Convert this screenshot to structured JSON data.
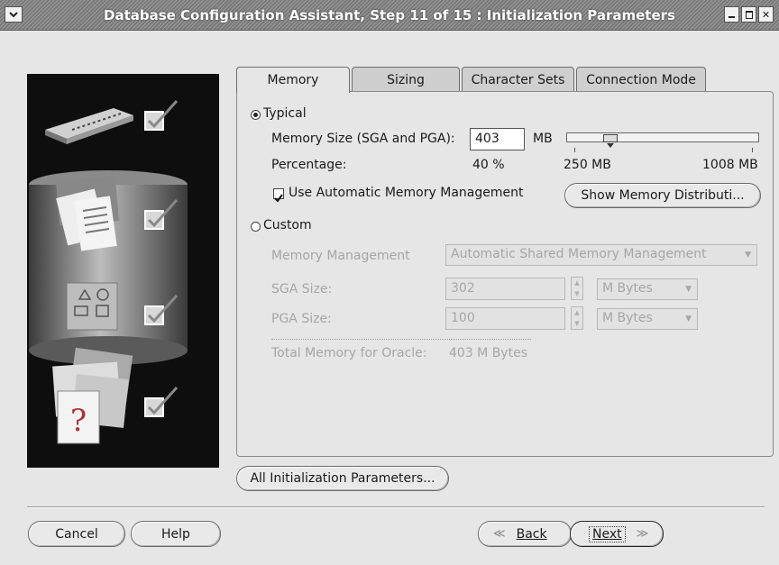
{
  "window": {
    "title": "Database Configuration Assistant, Step 11 of 15 : Initialization Parameters",
    "controls": [
      "minimize",
      "maximize",
      "close"
    ]
  },
  "tabs": [
    {
      "label": "Memory",
      "active": true
    },
    {
      "label": "Sizing",
      "active": false
    },
    {
      "label": "Character Sets",
      "active": false
    },
    {
      "label": "Connection Mode",
      "active": false
    }
  ],
  "memory": {
    "typical": {
      "label": "Typical",
      "selected": true,
      "memory_size_label": "Memory Size (SGA and PGA):",
      "memory_size_value": "403",
      "unit": "MB",
      "slider_min_label": "250 MB",
      "slider_max_label": "1008 MB",
      "slider_value_mb": 403,
      "percentage_label": "Percentage:",
      "percentage_value": "40 %",
      "amm_label": "Use Automatic Memory Management",
      "amm_checked": true,
      "show_distribution_button": "Show Memory Distributi..."
    },
    "custom": {
      "label": "Custom",
      "selected": false,
      "memory_management_label": "Memory Management",
      "memory_management_value": "Automatic Shared Memory Management",
      "sga_label": "SGA Size:",
      "sga_value": "302",
      "sga_unit": "M Bytes",
      "pga_label": "PGA Size:",
      "pga_value": "100",
      "pga_unit": "M Bytes",
      "total_label": "Total Memory for Oracle:",
      "total_value": "403 M Bytes"
    }
  },
  "buttons": {
    "all_params": "All Initialization Parameters...",
    "cancel": "Cancel",
    "help": "Help",
    "back": "Back",
    "next": "Next"
  },
  "left_panel": {
    "steps": [
      "memory-chip-icon",
      "document-icon",
      "shapes-icon",
      "help-folder-icon"
    ]
  }
}
